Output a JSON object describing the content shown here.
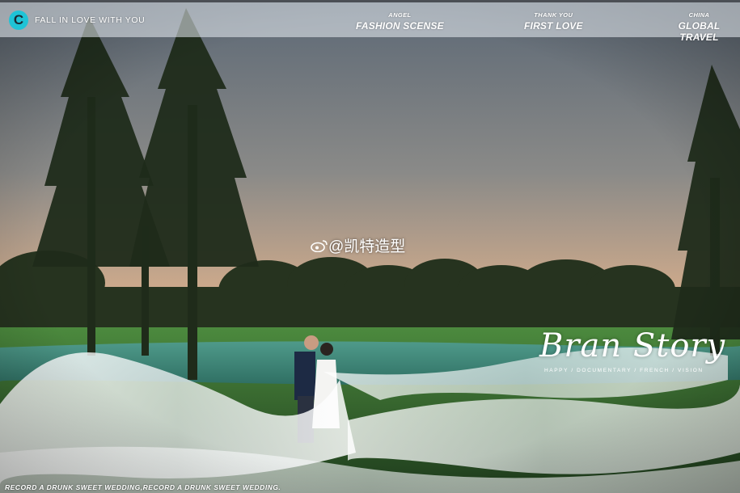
{
  "header": {
    "brand_text": "FALL IN LOVE WITH YOU",
    "logo_letter": "C",
    "nav": [
      {
        "sub": "ANGEL",
        "main": "FASHION SCENSE"
      },
      {
        "sub": "THANK YOU",
        "main": "FIRST LOVE"
      },
      {
        "sub": "CHINA",
        "main": "GLOBAL TRAVEL"
      }
    ]
  },
  "photo": {
    "watermark": "@凯特造型",
    "script_title": "Bran Story",
    "script_subtitle": "HAPPY / DOCUMENTARY / FRENCH / VISION"
  },
  "footer": {
    "text": "RECORD A DRUNK SWEET WEDDING,RECORD A DRUNK SWEET WEDDING."
  },
  "colors": {
    "logo_accent": "#1fc3d6",
    "sky_top": "#6d7a88",
    "sky_horizon": "#e4b48c",
    "grass": "#3f7a3a",
    "water": "#3d8f7f"
  }
}
